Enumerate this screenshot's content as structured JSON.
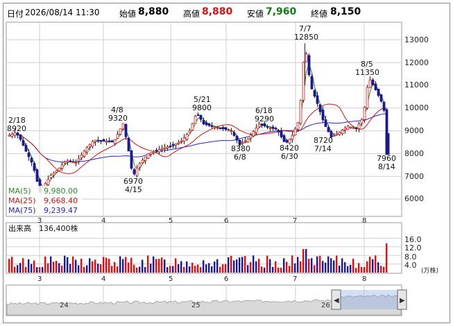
{
  "header": {
    "date_label": "日付",
    "datetime": "2026/08/14 11:30",
    "open_label": "始値",
    "open_value": "8,880",
    "high_label": "高値",
    "high_value": "8,880",
    "low_label": "安値",
    "low_value": "7,960",
    "close_label": "終値",
    "close_value": "8,150"
  },
  "colors": {
    "up": "#d41414",
    "down": "#1a1a8c",
    "ma5": "#2a8a2a",
    "ma25": "#d41414",
    "ma75": "#2323c8",
    "grid": "#cfcfcf"
  },
  "chart_data": [
    {
      "type": "candlestick",
      "y_ticks": [
        "6000",
        "7000",
        "8000",
        "9000",
        "10000",
        "11000",
        "12000",
        "13000"
      ],
      "ylim": [
        5500,
        13500
      ],
      "x_ticks": [
        "3",
        "4",
        "5",
        "6",
        "7",
        "8"
      ],
      "annotations": [
        {
          "label": "2/18",
          "value": "8920",
          "price": 8920
        },
        {
          "label": "4/8",
          "value": "9320",
          "price": 9320
        },
        {
          "label": "6970",
          "value": "4/15",
          "price": 6970
        },
        {
          "label": "5/21",
          "value": "9800",
          "price": 9800
        },
        {
          "label": "8380",
          "value": "6/8",
          "price": 8380
        },
        {
          "label": "6/18",
          "value": "9290",
          "price": 9290
        },
        {
          "label": "8420",
          "value": "6/30",
          "price": 8420
        },
        {
          "label": "7/7",
          "value": "12850",
          "price": 12850
        },
        {
          "label": "8720",
          "value": "7/14",
          "price": 8720
        },
        {
          "label": "8/5",
          "value": "11350",
          "price": 11350
        },
        {
          "label": "7960",
          "value": "8/14",
          "price": 7960
        }
      ],
      "legend": [
        {
          "name": "MA(5)",
          "value": "9,980.00"
        },
        {
          "name": "MA(25)",
          "value": "9,668.40"
        },
        {
          "name": "MA(75)",
          "value": "9,239.47"
        }
      ]
    },
    {
      "type": "bar",
      "title": "出来高",
      "current": "136,400株",
      "y_ticks": [
        "4.0",
        "8.0",
        "12.0",
        "16.0"
      ],
      "ylim": [
        0,
        20
      ],
      "unit": "(万株)",
      "x_ticks": [
        "3",
        "4",
        "5",
        "6",
        "7",
        "8"
      ]
    },
    {
      "type": "area",
      "x_ticks": [
        "24",
        "25",
        "26"
      ]
    }
  ]
}
